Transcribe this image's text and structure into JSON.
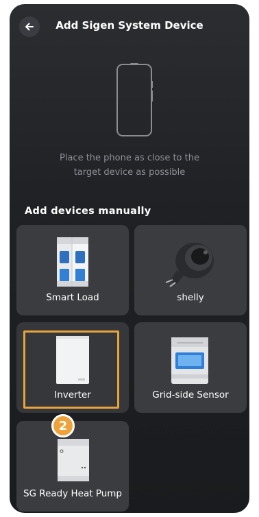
{
  "header": {
    "title": "Add Sigen System Device"
  },
  "hint": {
    "line1": "Place the phone as close to the",
    "line2": "target device as possible"
  },
  "section": {
    "title": "Add devices manually"
  },
  "devices": [
    {
      "label": "Smart Load",
      "icon": "breaker-icon"
    },
    {
      "label": "shelly",
      "icon": "smart-plug-icon"
    },
    {
      "label": "Inverter",
      "icon": "inverter-icon",
      "selected": true
    },
    {
      "label": "Grid-side Sensor",
      "icon": "meter-icon"
    },
    {
      "label": "SG Ready Heat Pump",
      "icon": "heat-pump-module-icon"
    }
  ],
  "badge": {
    "number": "2"
  },
  "colors": {
    "accent": "#e8a33a",
    "card_bg": "#3a3c40",
    "background": "#1f2124"
  }
}
